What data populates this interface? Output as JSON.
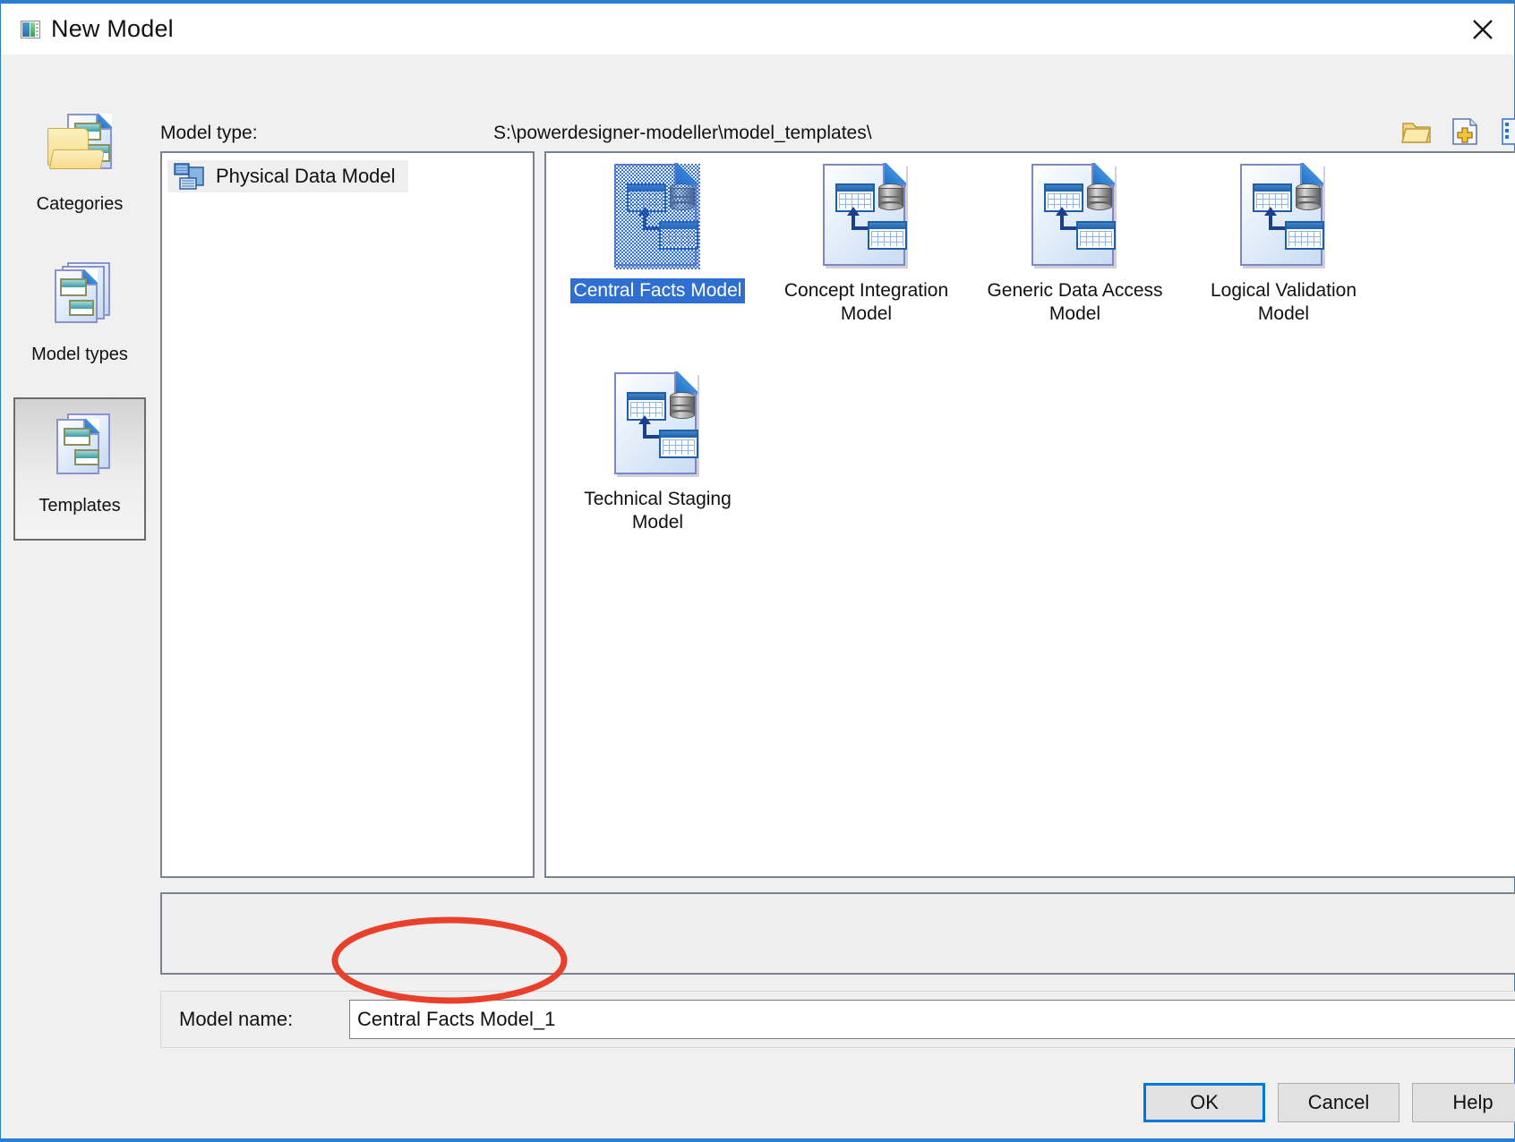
{
  "window": {
    "title": "New Model",
    "title_icon": "model-window-icon",
    "close_icon": "close-icon",
    "accent_color": "#2b7dd1"
  },
  "header": {
    "model_type_label": "Model type:",
    "path": "S:\\powerdesigner-modeller\\model_templates\\",
    "tools": [
      {
        "name": "open-folder-icon",
        "label": "Browse folder"
      },
      {
        "name": "new-document-icon",
        "label": "New from template"
      },
      {
        "name": "list-view-icon",
        "label": "View mode"
      }
    ]
  },
  "sidebar": {
    "items": [
      {
        "label": "Categories",
        "icon": "categories-icon",
        "selected": false
      },
      {
        "label": "Model types",
        "icon": "model-types-icon",
        "selected": false
      },
      {
        "label": "Templates",
        "icon": "templates-icon",
        "selected": true
      }
    ]
  },
  "tree": {
    "items": [
      {
        "label": "Physical Data Model",
        "icon": "physical-data-model-icon",
        "selected": true
      }
    ]
  },
  "templates": {
    "selected_color": "#2f6fd0",
    "items": [
      {
        "label": "Central Facts Model",
        "icon": "model-template-icon",
        "selected": true
      },
      {
        "label": "Concept Integration Model",
        "icon": "model-template-icon",
        "selected": false
      },
      {
        "label": "Generic Data Access Model",
        "icon": "model-template-icon",
        "selected": false
      },
      {
        "label": "Logical Validation Model",
        "icon": "model-template-icon",
        "selected": false
      },
      {
        "label": "Technical Staging Model",
        "icon": "model-template-icon",
        "selected": false
      }
    ]
  },
  "description": {
    "text": ""
  },
  "model_name": {
    "label": "Model name:",
    "value": "Central Facts Model_1",
    "placeholder": ""
  },
  "buttons": {
    "ok": "OK",
    "cancel": "Cancel",
    "help": "Help"
  },
  "annotation": {
    "shape": "ellipse",
    "color": "#e8402a",
    "target": "model-name-input"
  }
}
